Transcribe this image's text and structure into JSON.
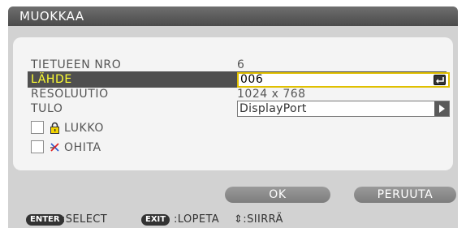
{
  "dialog": {
    "title": "MUOKKAA"
  },
  "fields": {
    "record_no": {
      "label": "TIETUEEN NRO",
      "value": "6"
    },
    "source": {
      "label": "LÄHDE",
      "value": "006"
    },
    "resolution": {
      "label": "RESOLUUTIO",
      "value": "1024 x 768"
    },
    "input": {
      "label": "TULO",
      "value": "DisplayPort"
    }
  },
  "checkboxes": {
    "lock": {
      "label": "LUKKO",
      "checked": false,
      "icon": "lock-icon"
    },
    "skip": {
      "label": "OHITA",
      "checked": false,
      "icon": "skip-icon"
    }
  },
  "buttons": {
    "ok": "OK",
    "cancel": "PERUUTA"
  },
  "footer": {
    "enter_key": "ENTER",
    "enter_action": ":SELECT",
    "exit_key": "EXIT",
    "exit_action": ":LOPETA",
    "move_hint": "⇕:SIIRRÄ"
  },
  "colors": {
    "title_bar": "#5a5a5a",
    "dialog_body": "#d2d2d2",
    "panel": "#f4f4f4",
    "selected_row": "#4f4f4f",
    "selected_label": "#ffff33",
    "input_border": "#e0c000",
    "button": "#8c8c8c"
  }
}
